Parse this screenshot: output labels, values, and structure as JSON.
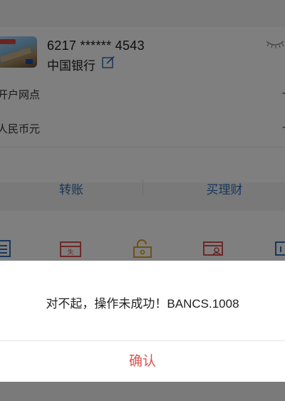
{
  "card": {
    "number": "6217 ****** 4543",
    "bank_name": "中国银行"
  },
  "info_rows": [
    {
      "label": "开户网点",
      "value": "--"
    },
    {
      "label": "人民币元",
      "value": "--"
    }
  ],
  "actions": {
    "transfer_label": "转账",
    "wealth_label": "买理财"
  },
  "colors": {
    "accent_blue": "#2f6fb7",
    "confirm_red": "#d9534f",
    "icon_red": "#d9534f",
    "icon_gold": "#e0a020"
  },
  "icons": [
    "list-icon",
    "ticket-icon",
    "unlock-icon",
    "card-user-icon",
    "card-partial-icon"
  ],
  "dialog": {
    "message": "对不起，操作未成功！BANCS.1008",
    "confirm_label": "确认"
  }
}
